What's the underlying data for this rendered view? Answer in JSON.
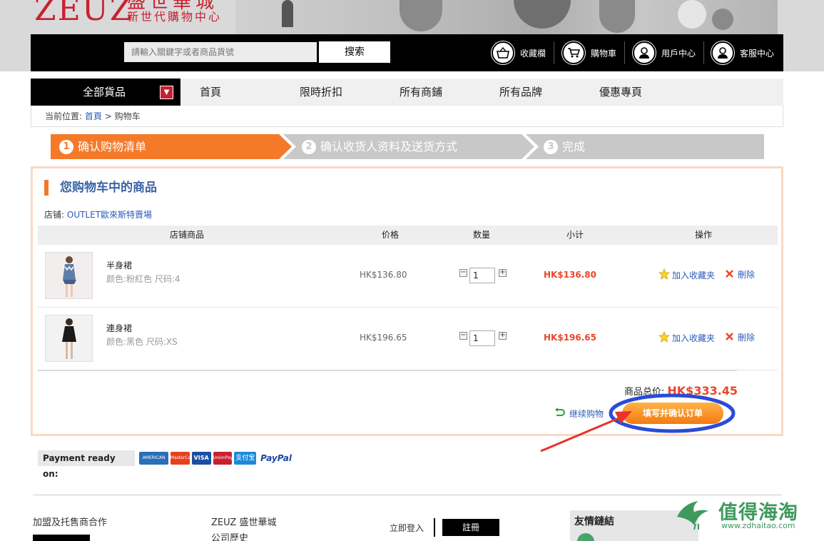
{
  "header": {
    "logo_text": "ZEUZ",
    "logo_cn_line1": "盛世華城",
    "logo_cn_line2": "新世代購物中心",
    "search_placeholder": "請輸入關鍵字或者商品貨號",
    "search_button": "搜索",
    "links": [
      {
        "label": "收藏欄",
        "icon": "basket-icon"
      },
      {
        "label": "購物車",
        "icon": "cart-icon"
      },
      {
        "label": "用戶中心",
        "icon": "user-icon"
      },
      {
        "label": "客服中心",
        "icon": "support-icon"
      }
    ]
  },
  "nav": {
    "all_goods": "全部貨品",
    "items": [
      "首頁",
      "限時折扣",
      "所有商鋪",
      "所有品牌",
      "優惠專頁"
    ]
  },
  "breadcrumb": {
    "prefix": "当前位置:",
    "home": "首頁",
    "separator": ">",
    "current": "购物车"
  },
  "steps": [
    {
      "num": "1",
      "label": "确认购物清单",
      "active": true
    },
    {
      "num": "2",
      "label": "确认收货人资料及送货方式",
      "active": false
    },
    {
      "num": "3",
      "label": "完成",
      "active": false
    }
  ],
  "cart": {
    "title": "您购物车中的商品",
    "store_label": "店铺:",
    "store_name": "OUTLET歐來斯特賣場",
    "columns": [
      "店铺商品",
      "价格",
      "数量",
      "小计",
      "操作"
    ],
    "items": [
      {
        "name": "半身裙",
        "attrs": "颜色:粉紅色 尺码:4",
        "price": "HK$136.80",
        "qty": "1",
        "subtotal": "HK$136.80",
        "fav": "加入收藏夹",
        "del": "刪除"
      },
      {
        "name": "連身裙",
        "attrs": "颜色:黑色 尺码:XS",
        "price": "HK$196.65",
        "qty": "1",
        "subtotal": "HK$196.65",
        "fav": "加入收藏夹",
        "del": "刪除"
      }
    ],
    "total_label": "商品总价:",
    "total_value": "HK$333.45",
    "continue": "继续购物",
    "confirm": "填写并确认订单"
  },
  "payment": {
    "label": "Payment ready on:",
    "methods": [
      {
        "name": "AMERICAN EXPRESS",
        "color": "#2a6fb8"
      },
      {
        "name": "MasterCard",
        "color": "#e8401c"
      },
      {
        "name": "VISA",
        "color": "#1a4fa0"
      },
      {
        "name": "UnionPay",
        "color": "#c8202f"
      },
      {
        "name": "支付宝",
        "color": "#1c8ad8"
      }
    ],
    "paypal": "PayPal"
  },
  "footer": {
    "col1_title": "加盟及托售商合作",
    "col2_title": "ZEUZ 盛世華城",
    "col2_sub": "公司歷史",
    "login": "立即登入",
    "register": "註冊",
    "friends": "友情鏈結"
  },
  "watermark": {
    "cn": "值得海淘",
    "url": "www.zdhaitao.com"
  },
  "colors": {
    "accent_orange": "#f47a2a",
    "brand_red": "#c8202f",
    "link_blue": "#2b5bb8",
    "price_red": "#e8462a",
    "step_grey": "#c8c8c8"
  }
}
